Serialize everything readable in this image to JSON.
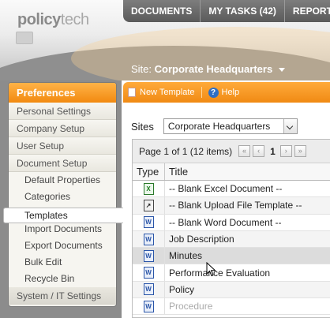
{
  "brand": {
    "logo_bold": "policy",
    "logo_light": "tech"
  },
  "topnav": [
    "DOCUMENTS",
    "MY TASKS (42)",
    "REPORTS"
  ],
  "site_selector": {
    "label": "Site:",
    "value": "Corporate Headquarters"
  },
  "sidebar": {
    "header": "Preferences",
    "items": [
      {
        "label": "Personal Settings"
      },
      {
        "label": "Company Setup"
      },
      {
        "label": "User Setup"
      },
      {
        "label": "Document Setup"
      }
    ],
    "sub_items": [
      {
        "label": "Default Properties"
      },
      {
        "label": "Categories"
      },
      {
        "label": "Templates",
        "active": true
      },
      {
        "label": "Import Documents"
      },
      {
        "label": "Export Documents"
      },
      {
        "label": "Bulk Edit"
      },
      {
        "label": "Recycle Bin"
      }
    ],
    "bottom_item": "System / IT Settings"
  },
  "toolbar": {
    "new_template": "New Template",
    "help": "Help"
  },
  "sites_filter": {
    "label": "Sites",
    "value": "Corporate Headquarters"
  },
  "pager": {
    "text": "Page 1 of 1 (12 items)",
    "current": "1"
  },
  "table": {
    "columns": [
      "Type",
      "Title"
    ],
    "rows": [
      {
        "icon": "excel-icon",
        "title": "-- Blank Excel Document --"
      },
      {
        "icon": "upload-icon",
        "title": "-- Blank Upload File Template --"
      },
      {
        "icon": "word-icon",
        "title": "-- Blank Word Document --"
      },
      {
        "icon": "word-icon",
        "title": "Job Description"
      },
      {
        "icon": "word-icon",
        "title": "Minutes"
      },
      {
        "icon": "word-icon",
        "title": "Performance Evaluation"
      },
      {
        "icon": "word-icon",
        "title": "Policy"
      },
      {
        "icon": "word-icon",
        "title": "Procedure"
      }
    ]
  },
  "colors": {
    "accent_orange": "#f28a10",
    "nav_gray": "#5a5a5a",
    "word_blue": "#2a55a8",
    "excel_green": "#1c7a1c"
  }
}
